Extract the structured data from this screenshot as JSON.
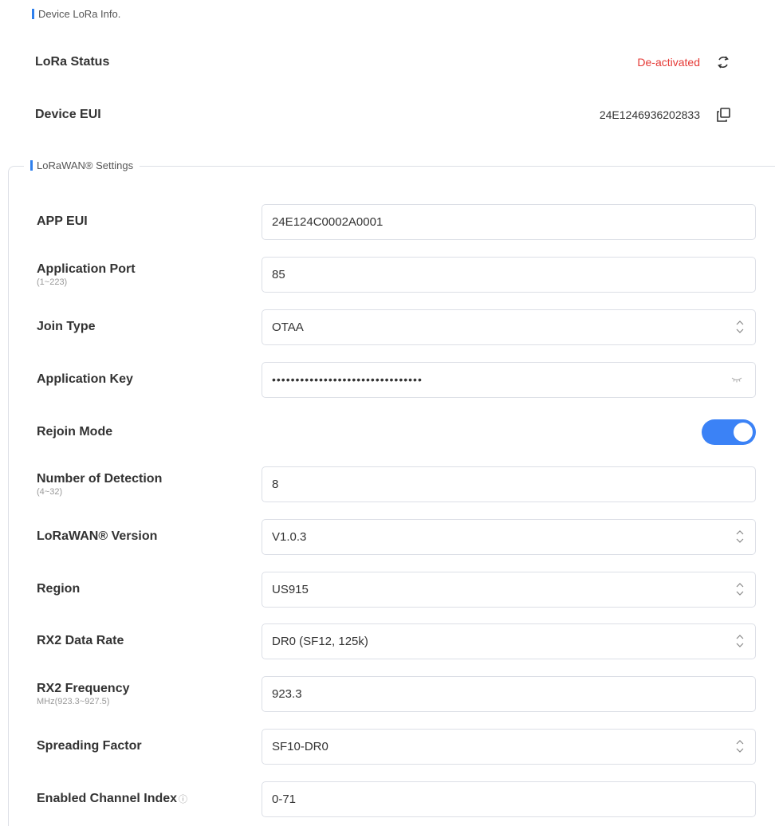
{
  "device_info": {
    "title": "Device LoRa Info.",
    "lora_status": {
      "label": "LoRa Status",
      "value": "De-activated",
      "icon": "refresh-icon"
    },
    "device_eui": {
      "label": "Device EUI",
      "value": "24E1246936202833",
      "icon": "copy-icon"
    }
  },
  "settings": {
    "title": "LoRaWAN® Settings",
    "app_eui": {
      "label": "APP EUI",
      "value": "24E124C0002A0001"
    },
    "application_port": {
      "label": "Application Port",
      "hint": "(1~223)",
      "value": "85"
    },
    "join_type": {
      "label": "Join Type",
      "value": "OTAA"
    },
    "application_key": {
      "label": "Application Key",
      "value": "••••••••••••••••••••••••••••••••",
      "icon": "eye-closed-icon"
    },
    "rejoin_mode": {
      "label": "Rejoin Mode",
      "enabled": true
    },
    "number_of_detection": {
      "label": "Number of Detection",
      "hint": "(4~32)",
      "value": "8"
    },
    "lorawan_version": {
      "label": "LoRaWAN® Version",
      "value": "V1.0.3"
    },
    "region": {
      "label": "Region",
      "value": "US915"
    },
    "rx2_data_rate": {
      "label": "RX2 Data Rate",
      "value": "DR0 (SF12, 125k)"
    },
    "rx2_frequency": {
      "label": "RX2 Frequency",
      "hint": "MHz(923.3~927.5)",
      "value": "923.3"
    },
    "spreading_factor": {
      "label": "Spreading Factor",
      "value": "SF10-DR0"
    },
    "enabled_channel_index": {
      "label": "Enabled Channel Index",
      "value": "0-71",
      "icon": "info-icon"
    }
  },
  "colors": {
    "accent": "#3b82f6",
    "status_inactive": "#e53935",
    "border": "#dcdfe6"
  }
}
